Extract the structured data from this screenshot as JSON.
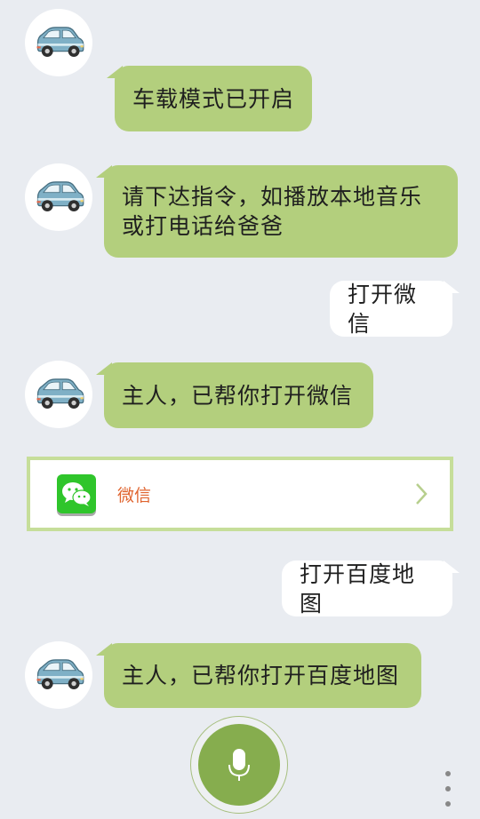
{
  "messages": [
    {
      "from": "bot",
      "text": "车载模式已开启"
    },
    {
      "from": "bot",
      "text": "请下达指令，如播放本地音乐或打电话给爸爸"
    },
    {
      "from": "user",
      "text": "打开微信"
    },
    {
      "from": "bot",
      "text": "主人，已帮你打开微信"
    },
    {
      "from": "user",
      "text": "打开百度地图"
    },
    {
      "from": "bot",
      "text": "主人，已帮你打开百度地图"
    }
  ],
  "app_card": {
    "name": "微信",
    "icon": "wechat-icon"
  },
  "controls": {
    "mic_icon": "microphone-icon",
    "more_icon": "more-vertical-icon"
  },
  "colors": {
    "background": "#e9ecf1",
    "bot_bubble": "#b3cf7d",
    "user_bubble": "#ffffff",
    "mic_button": "#86ad4e",
    "app_name": "#e0642f",
    "card_border": "#c6de9a"
  }
}
